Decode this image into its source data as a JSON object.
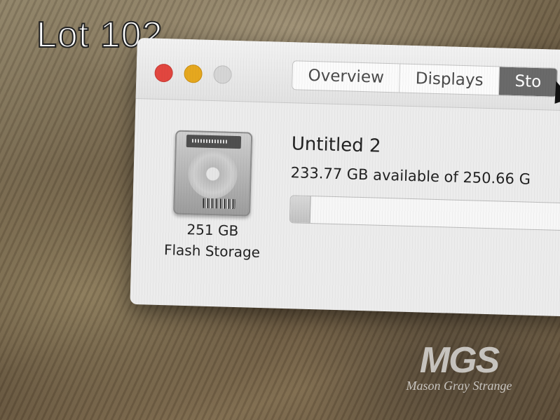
{
  "overlay": {
    "lot_label": "Lot 102"
  },
  "window": {
    "tabs": [
      {
        "label": "Overview",
        "active": false
      },
      {
        "label": "Displays",
        "active": false
      },
      {
        "label": "Sto",
        "active": true
      }
    ]
  },
  "storage": {
    "disk_size": "251 GB",
    "disk_type": "Flash Storage",
    "volume_name": "Untitled 2",
    "availability_text": "233.77 GB available of 250.66 G",
    "used_fraction": 0.067
  },
  "watermark": {
    "logo": "MGS",
    "name": "Mason Gray Strange"
  },
  "colors": {
    "close": "#e2463f",
    "minimize": "#e6a81e",
    "zoom": "#d6d6d6",
    "active_tab": "#6a6a6a"
  },
  "icons": [
    "close-icon",
    "minimize-icon",
    "zoom-icon",
    "hard-disk-icon",
    "pointer-cursor-icon"
  ]
}
